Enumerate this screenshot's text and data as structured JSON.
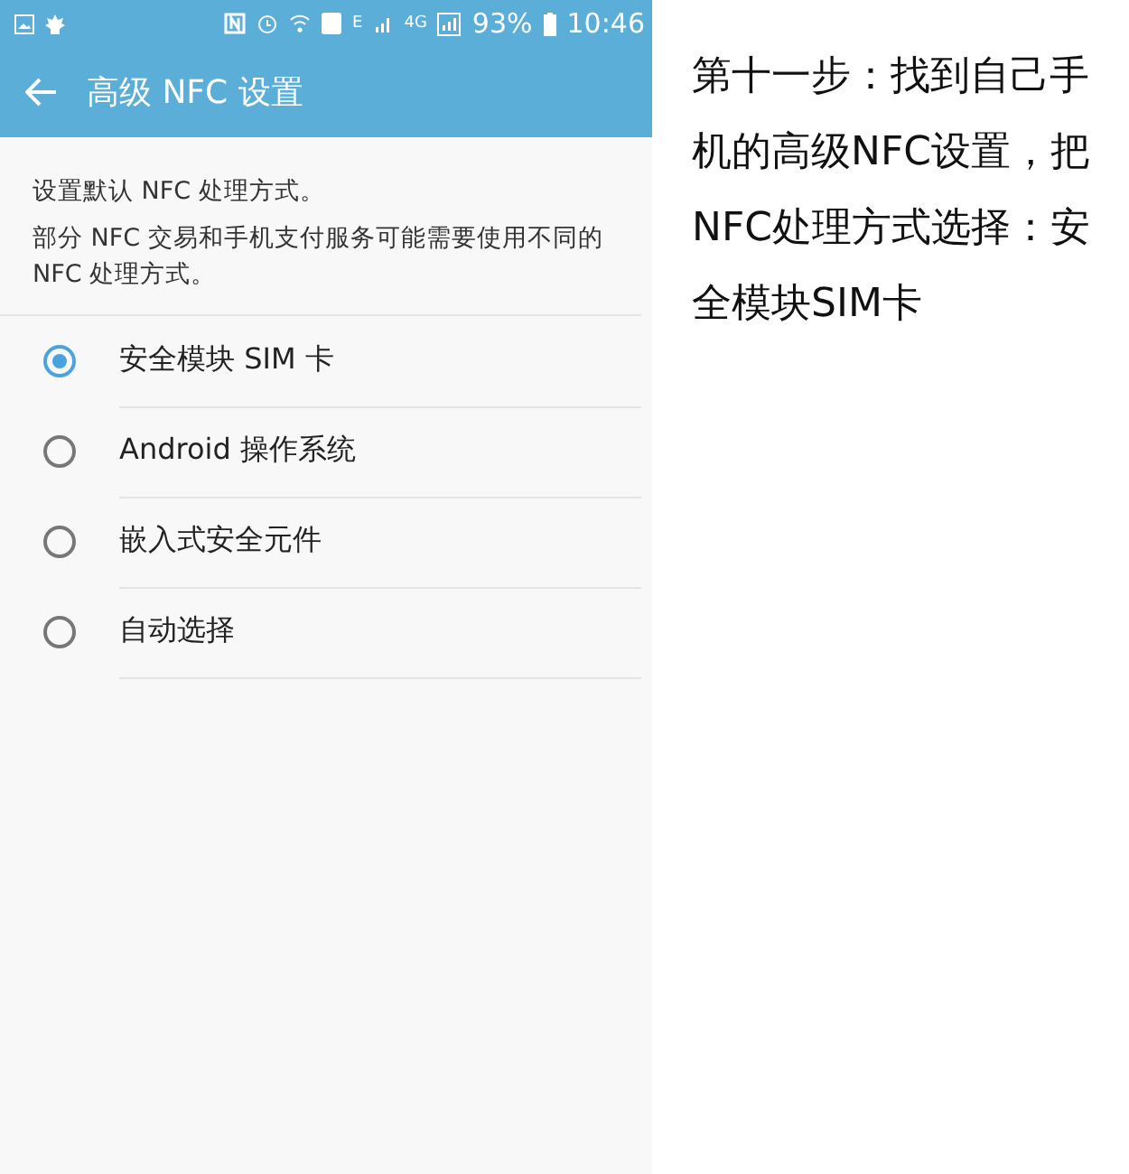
{
  "status_bar": {
    "sim_network": "E",
    "data_network": "4G",
    "battery": "93%",
    "time": "10:46"
  },
  "app_bar": {
    "title": "高级 NFC 设置"
  },
  "description": [
    "设置默认 NFC 处理方式。",
    "部分 NFC 交易和手机支付服务可能需要使用不同的 NFC 处理方式。"
  ],
  "options": [
    {
      "label": "安全模块 SIM 卡",
      "selected": true
    },
    {
      "label": "Android 操作系统",
      "selected": false
    },
    {
      "label": "嵌入式安全元件",
      "selected": false
    },
    {
      "label": "自动选择",
      "selected": false
    }
  ],
  "caption": "第十一步：找到自己手机的高级NFC设置，把NFC处理方式选择：安全模块SIM卡"
}
